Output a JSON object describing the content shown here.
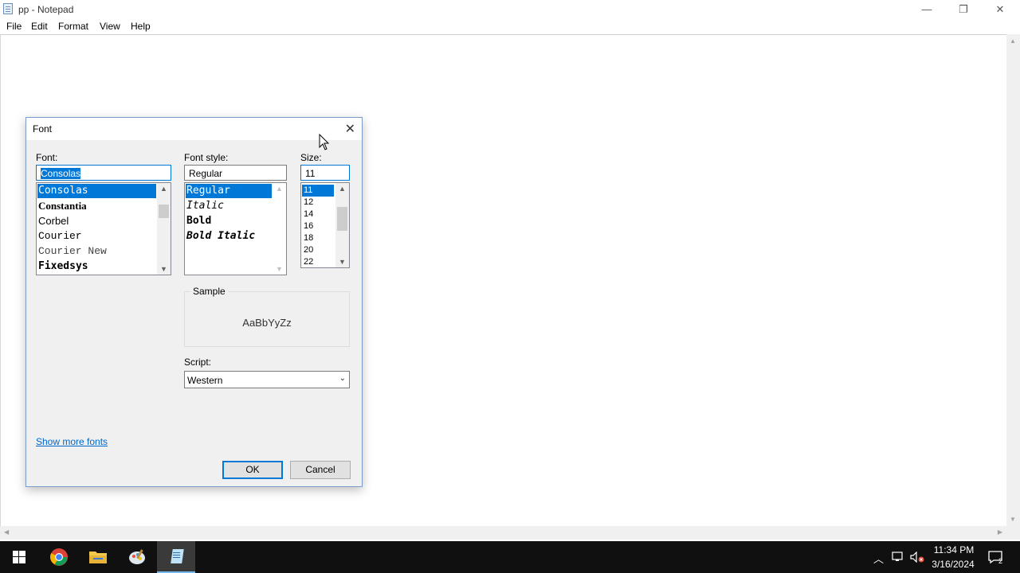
{
  "window": {
    "title": "pp - Notepad",
    "minimize_glyph": "—",
    "restore_glyph": "❐",
    "close_glyph": "✕"
  },
  "menu": [
    "File",
    "Edit",
    "Format",
    "View",
    "Help"
  ],
  "dialog": {
    "title": "Font",
    "font_label": "Font:",
    "font_value": "Consolas",
    "font_list": [
      "Consolas",
      "Constantia",
      "Corbel",
      "Courier",
      "Courier New",
      "Fixedsys"
    ],
    "style_label": "Font style:",
    "style_value": "Regular",
    "style_list": [
      "Regular",
      "Italic",
      "Bold",
      "Bold Italic"
    ],
    "size_label": "Size:",
    "size_value": "11",
    "size_list": [
      "11",
      "12",
      "14",
      "16",
      "18",
      "20",
      "22"
    ],
    "sample_label": "Sample",
    "sample_text": "AaBbYyZz",
    "script_label": "Script:",
    "script_value": "Western",
    "show_more_link": "Show more fonts",
    "ok_label": "OK",
    "cancel_label": "Cancel"
  },
  "taskbar": {
    "apps": [
      "start-icon",
      "chrome-icon",
      "file-explorer-icon",
      "paint-icon",
      "notepad-icon"
    ],
    "time": "11:34 PM",
    "date": "3/16/2024",
    "notification_count": "2"
  },
  "colors": {
    "selection": "#0078d7",
    "taskbar": "#101010",
    "dialog_bg": "#f0f0f0"
  }
}
